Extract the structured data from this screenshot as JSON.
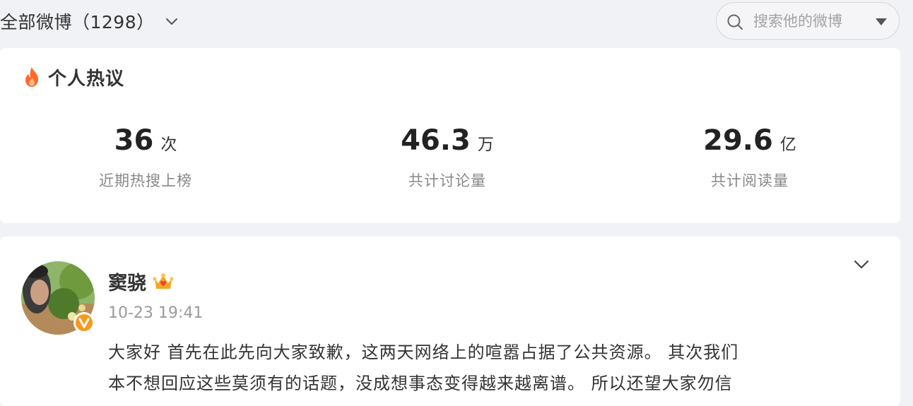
{
  "header": {
    "filter_label": "全部微博（1298）",
    "search": {
      "placeholder": "搜索他的微博"
    }
  },
  "stats": {
    "title": "个人热议",
    "items": [
      {
        "value": "36",
        "unit": "次",
        "label": "近期热搜上榜"
      },
      {
        "value": "46.3",
        "unit": "万",
        "label": "共计讨论量"
      },
      {
        "value": "29.6",
        "unit": "亿",
        "label": "共计阅读量"
      }
    ]
  },
  "post": {
    "author": "窦骁",
    "time": "10-23 19:41",
    "text_lines": [
      "大家好 首先在此先向大家致歉，这两天网络上的喧嚣占据了公共资源。 其次我们",
      "本不想回应这些莫须有的话题，没成想事态变得越来越离谱。 所以还望大家勿信"
    ]
  },
  "colors": {
    "page_background": "#f1f2f5",
    "card_background": "#ffffff",
    "fire": "#ff6a2b",
    "verify_badge": "#f59a1f",
    "member_crown": "#f5a623"
  },
  "icons": {
    "filter": "chevron-down-icon",
    "search": "search-icon",
    "search_dropdown": "caret-down-icon",
    "stats_header": "fire-icon",
    "verify": "verified-v-icon",
    "member": "member-crown-icon",
    "post_menu": "chevron-down-icon"
  }
}
